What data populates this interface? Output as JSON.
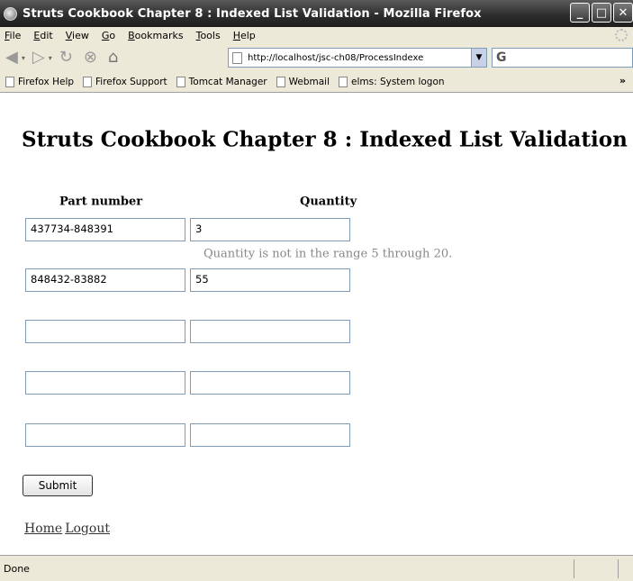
{
  "window": {
    "title": "Struts Cookbook Chapter 8 : Indexed List Validation - Mozilla Firefox",
    "buttons": [
      "_",
      "□",
      "✕"
    ]
  },
  "menu": [
    "File",
    "Edit",
    "View",
    "Go",
    "Bookmarks",
    "Tools",
    "Help"
  ],
  "toolbar": {
    "url": "http://localhost/jsc-ch08/ProcessIndexe",
    "search_value": "G"
  },
  "bookmarks": [
    "Firefox Help",
    "Firefox Support",
    "Tomcat Manager",
    "Webmail",
    "elms: System logon"
  ],
  "bookmarks_more": "»",
  "page": {
    "title": "Struts Cookbook Chapter 8 : Indexed List Validation",
    "col_part": "Part number",
    "col_qty": "Quantity",
    "rows": [
      {
        "part": "437734-848391",
        "qty": "3"
      },
      {
        "part": "848432-83882",
        "qty": "55"
      },
      {
        "part": "",
        "qty": ""
      },
      {
        "part": "",
        "qty": ""
      },
      {
        "part": "",
        "qty": ""
      }
    ],
    "error": "Quantity is not in the range 5 through 20.",
    "submit_label": "Submit",
    "links": {
      "home": "Home",
      "logout": "Logout"
    }
  },
  "status": {
    "text": "Done"
  }
}
